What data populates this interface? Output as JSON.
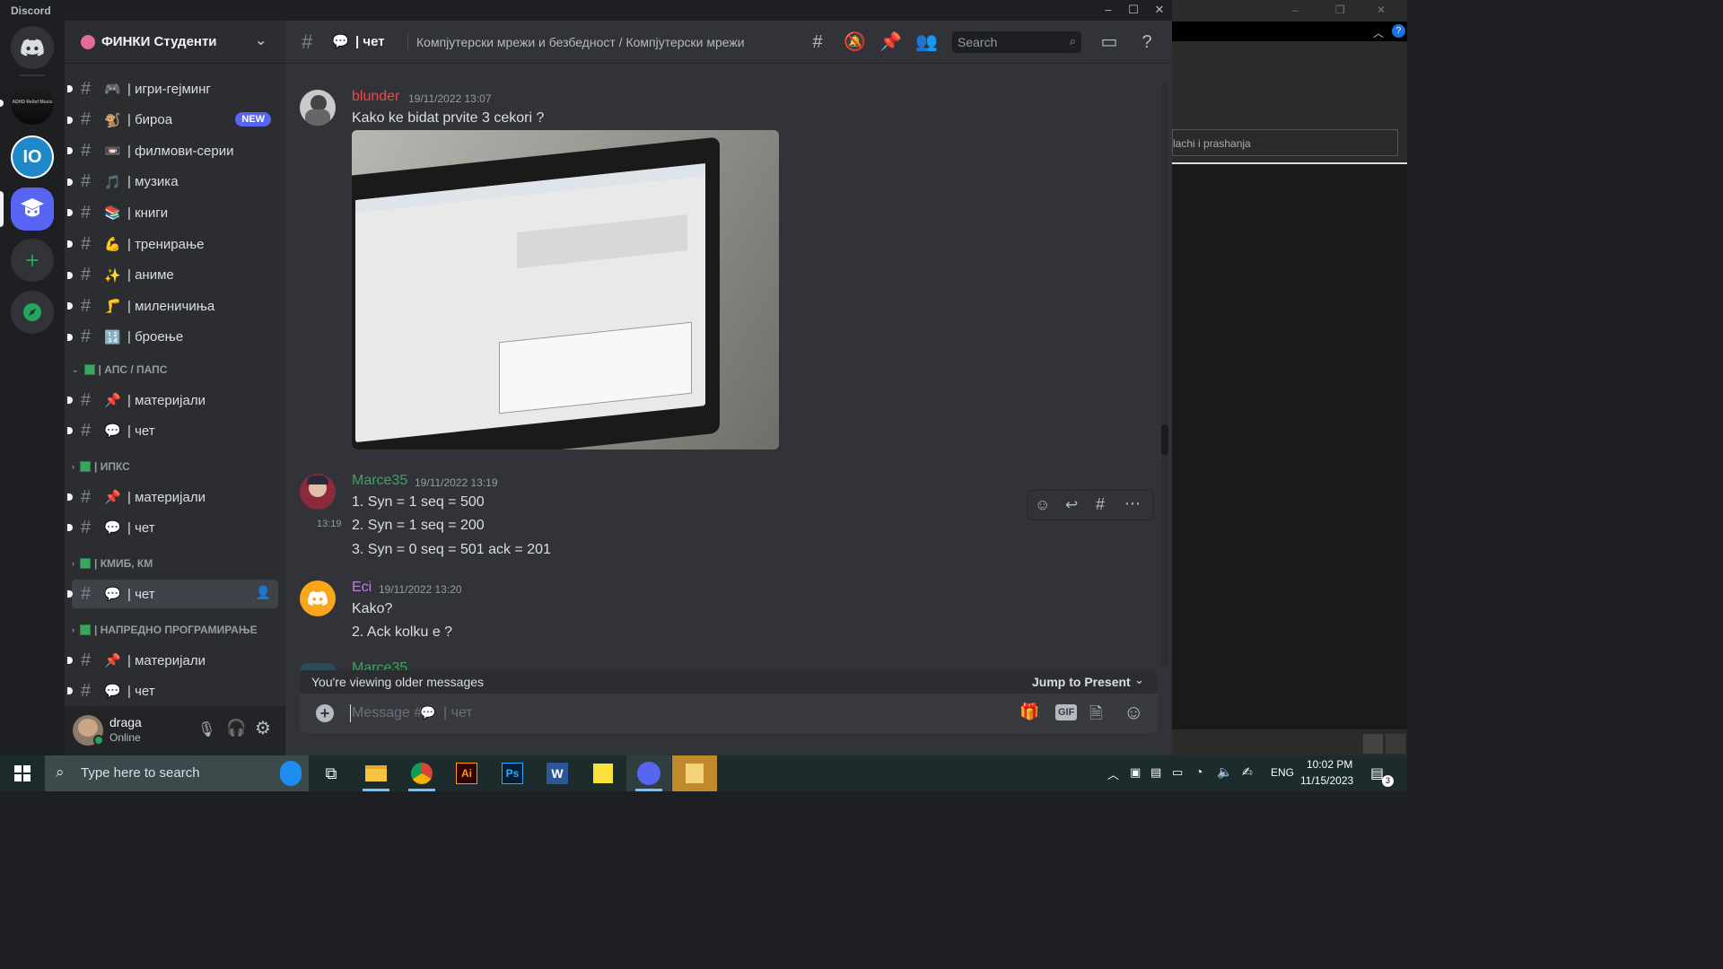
{
  "window": {
    "title": "Discord",
    "controls": [
      "–",
      "☐",
      "✕"
    ]
  },
  "background_window": {
    "input_text": "lachi i prashanja",
    "controls": [
      "–",
      "❐",
      "✕"
    ],
    "help": "?"
  },
  "server_rail": {
    "items": [
      {
        "name": "discord-home",
        "label": ""
      },
      {
        "name": "adhd-relief-music",
        "label": "ADHD Relief Music"
      },
      {
        "name": "server-io",
        "label": "IO"
      },
      {
        "name": "server-finki",
        "label": ""
      },
      {
        "name": "add-server",
        "label": "+"
      },
      {
        "name": "explore",
        "label": "◆"
      }
    ]
  },
  "sidebar": {
    "server_name": "ФИНКИ Студенти",
    "channels_top": [
      {
        "emoji": "🎮",
        "name": "| игри-гејминг"
      },
      {
        "emoji": "🐒",
        "name": "| бироа",
        "badge": "NEW"
      },
      {
        "emoji": "📼",
        "name": "| филмови-серии"
      },
      {
        "emoji": "🎵",
        "name": "| музика"
      },
      {
        "emoji": "📚",
        "name": "| книги"
      },
      {
        "emoji": "💪",
        "name": "| тренирање"
      },
      {
        "emoji": "✨",
        "name": "| аниме"
      },
      {
        "emoji": "🦵",
        "name": "| миленичиња"
      },
      {
        "emoji": "🔢",
        "name": "| броење"
      }
    ],
    "categories": [
      {
        "label": "| АПС / ПАПС",
        "channels": [
          {
            "emoji": "📌",
            "name": "| материјали"
          },
          {
            "emoji": "💬",
            "name": "| чет"
          }
        ]
      },
      {
        "label": "| ИПКС",
        "channels": [
          {
            "emoji": "📌",
            "name": "| материјали"
          },
          {
            "emoji": "💬",
            "name": "| чет"
          }
        ]
      },
      {
        "label": "| КМИБ, КМ",
        "channels": [
          {
            "emoji": "💬",
            "name": "| чет"
          }
        ]
      },
      {
        "label": "| НАПРЕДНО ПРОГРАМИРАЊЕ",
        "channels": [
          {
            "emoji": "📌",
            "name": "| материјали"
          },
          {
            "emoji": "💬",
            "name": "| чет"
          }
        ]
      }
    ]
  },
  "user": {
    "name": "draga",
    "status": "Online"
  },
  "chat_header": {
    "channel_emoji": "💬",
    "channel_name": "| чет",
    "topic": "Компјутерски мрежи и безбедност / Компјутерски мрежи",
    "search_placeholder": "Search"
  },
  "messages": [
    {
      "author": "blunder",
      "author_color": "#f04747",
      "timestamp": "19/11/2022 13:07",
      "lines": [
        "Kako ke bidat prvite 3 cekori ?"
      ],
      "has_image": true
    },
    {
      "author": "Marce35",
      "author_color": "#3ba55d",
      "timestamp": "19/11/2022 13:19",
      "hover_time": "13:19",
      "lines": [
        "1.  Syn = 1 seq = 500",
        "2.  Syn = 1 seq = 200",
        "3.  Syn = 0 seq = 501 ack = 201"
      ]
    },
    {
      "author": "Eci",
      "author_color": "#c27ce6",
      "timestamp": "19/11/2022 13:20",
      "lines": [
        "Kako?",
        "2. Ack kolku e ?"
      ]
    }
  ],
  "partial_next_author": "Marce35",
  "older_bar": {
    "text": "You're viewing older messages",
    "jump": "Jump to Present"
  },
  "composer": {
    "placeholder_prefix": "Message #",
    "placeholder_channel": "| чет",
    "gif": "GIF"
  },
  "taskbar": {
    "search_placeholder": "Type here to search",
    "language": "ENG",
    "time": "10:02 PM",
    "date": "11/15/2023",
    "notification_count": "3"
  },
  "colors": {
    "accent": "#5865f2",
    "green": "#23a55a",
    "link_green": "#3ba55d"
  }
}
